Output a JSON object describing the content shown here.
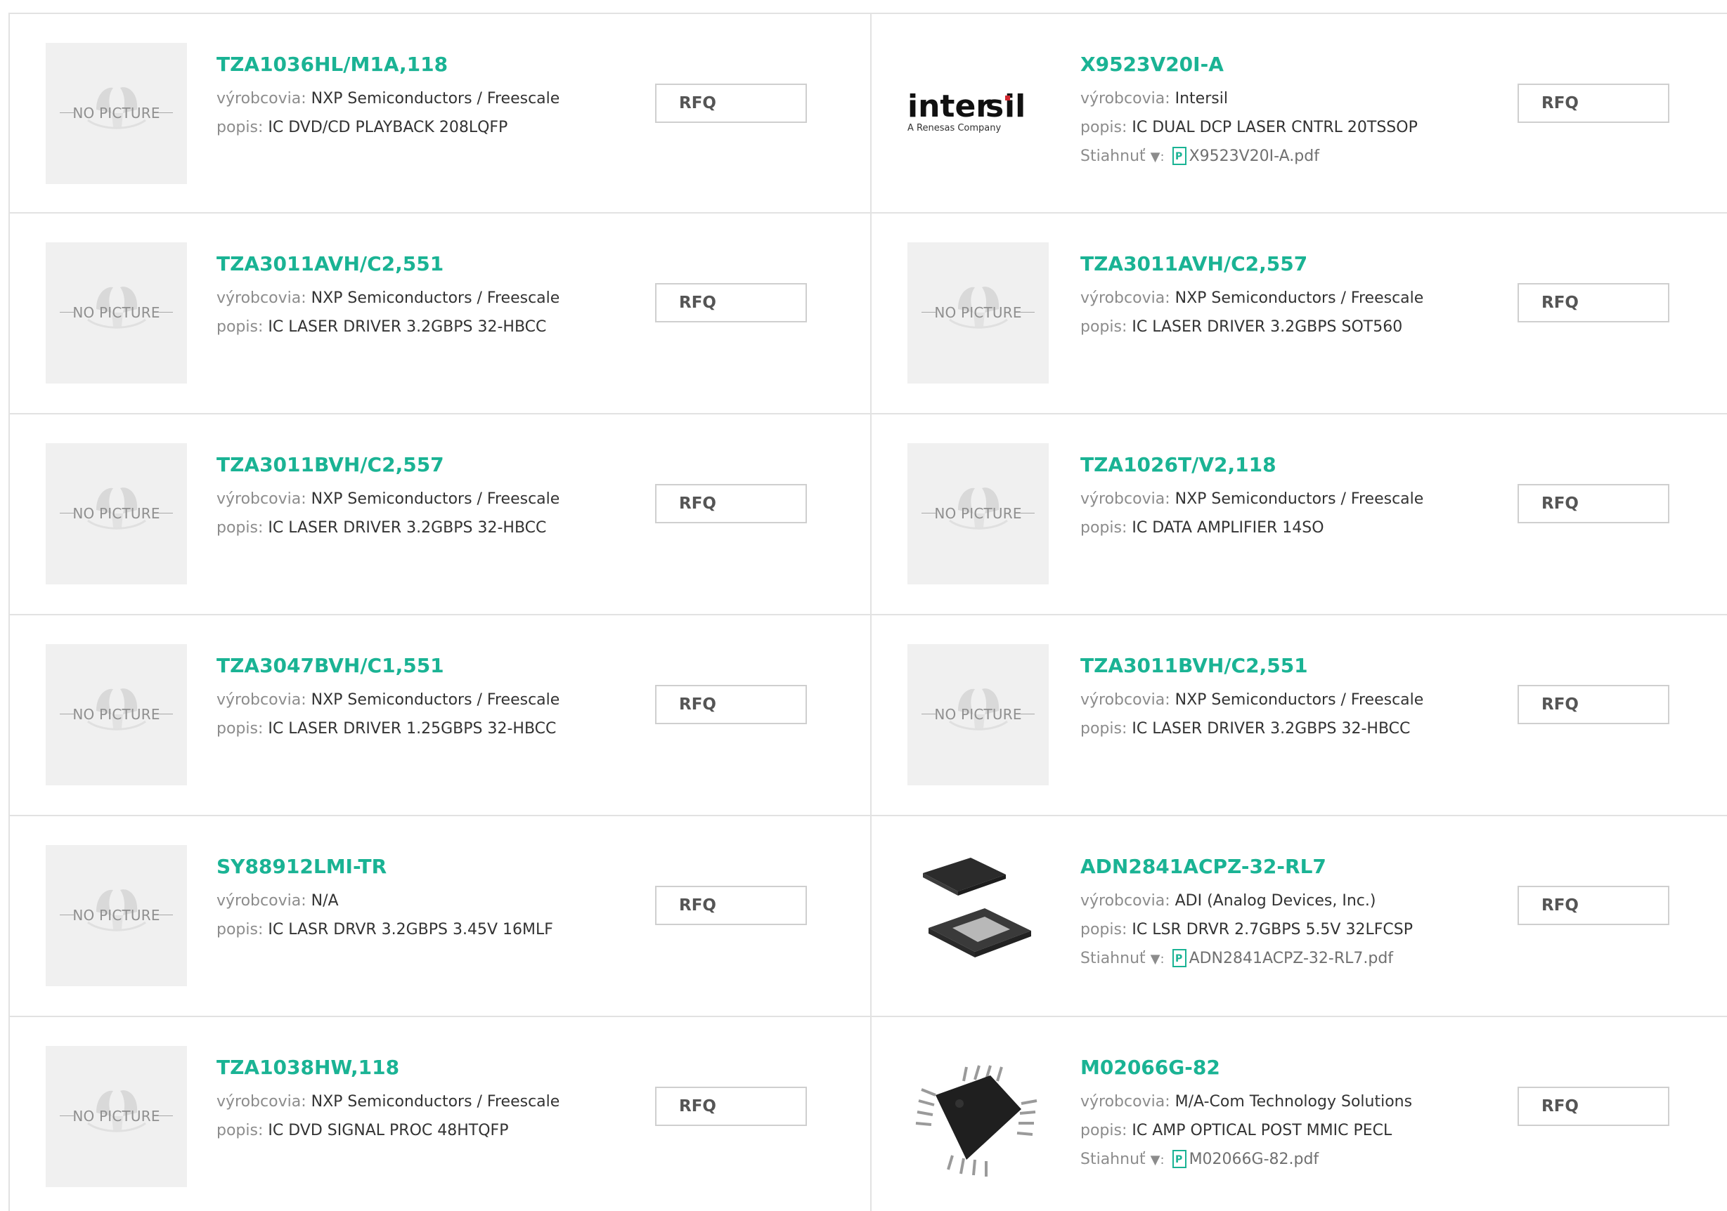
{
  "labels": {
    "manufacturer": "výrobcovia:",
    "description": "popis:",
    "download": "Stiahnuť",
    "download_arrow": "▼:",
    "rfq": "RFQ",
    "no_picture": "NO PICTURE"
  },
  "brand": {
    "accent": "#1ab394",
    "intersil_logo_text": "intersil",
    "intersil_logo_sub": "A Renesas Company"
  },
  "products": [
    {
      "part": "TZA1036HL/M1A,118",
      "manufacturer": "NXP Semiconductors / Freescale",
      "description": "IC DVD/CD PLAYBACK 208LQFP",
      "image": "no-picture",
      "pdf": null
    },
    {
      "part": "X9523V20I-A",
      "manufacturer": "Intersil",
      "description": "IC DUAL DCP LASER CNTRL 20TSSOP",
      "image": "intersil-logo",
      "pdf": "X9523V20I-A.pdf"
    },
    {
      "part": "TZA3011AVH/C2,551",
      "manufacturer": "NXP Semiconductors / Freescale",
      "description": "IC LASER DRIVER 3.2GBPS 32-HBCC",
      "image": "no-picture",
      "pdf": null
    },
    {
      "part": "TZA3011AVH/C2,557",
      "manufacturer": "NXP Semiconductors / Freescale",
      "description": "IC LASER DRIVER 3.2GBPS SOT560",
      "image": "no-picture",
      "pdf": null
    },
    {
      "part": "TZA3011BVH/C2,557",
      "manufacturer": "NXP Semiconductors / Freescale",
      "description": "IC LASER DRIVER 3.2GBPS 32-HBCC",
      "image": "no-picture",
      "pdf": null
    },
    {
      "part": "TZA1026T/V2,118",
      "manufacturer": "NXP Semiconductors / Freescale",
      "description": "IC DATA AMPLIFIER 14SO",
      "image": "no-picture",
      "pdf": null
    },
    {
      "part": "TZA3047BVH/C1,551",
      "manufacturer": "NXP Semiconductors / Freescale",
      "description": "IC LASER DRIVER 1.25GBPS 32-HBCC",
      "image": "no-picture",
      "pdf": null
    },
    {
      "part": "TZA3011BVH/C2,551",
      "manufacturer": "NXP Semiconductors / Freescale",
      "description": "IC LASER DRIVER 3.2GBPS 32-HBCC",
      "image": "no-picture",
      "pdf": null
    },
    {
      "part": "SY88912LMI-TR",
      "manufacturer": "N/A",
      "description": "IC LASR DRVR 3.2GBPS 3.45V 16MLF",
      "image": "no-picture",
      "pdf": null
    },
    {
      "part": "ADN2841ACPZ-32-RL7",
      "manufacturer": "ADI (Analog Devices, Inc.)",
      "description": "IC LSR DRVR 2.7GBPS 5.5V 32LFCSP",
      "image": "qfn-chip-photo",
      "pdf": "ADN2841ACPZ-32-RL7.pdf"
    },
    {
      "part": "TZA1038HW,118",
      "manufacturer": "NXP Semiconductors / Freescale",
      "description": "IC DVD SIGNAL PROC 48HTQFP",
      "image": "no-picture",
      "pdf": null
    },
    {
      "part": "M02066G-82",
      "manufacturer": "M/A-Com Technology Solutions",
      "description": "IC AMP OPTICAL POST MMIC PECL",
      "image": "qfp-chip-photo",
      "pdf": "M02066G-82.pdf"
    }
  ]
}
